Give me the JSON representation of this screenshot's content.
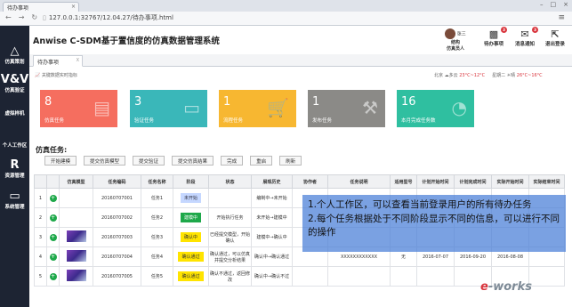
{
  "browser": {
    "tab_title": "待办事项",
    "url_host": "127.0.0.1",
    "url_path": ":32767/12.04.27/待办事项.html"
  },
  "sidebar": {
    "items": [
      {
        "label": "仿真策划",
        "icon": "triangle-icon"
      },
      {
        "label": "仿真验证",
        "icon": "vv-icon"
      },
      {
        "label": "虚拟样机",
        "icon": "prototype-icon"
      },
      {
        "label": "个人工作区",
        "icon": "workspace-icon"
      },
      {
        "label": "资源管理",
        "icon": "resource-icon"
      },
      {
        "label": "系统管理",
        "icon": "system-icon"
      }
    ]
  },
  "header": {
    "title": "Anwise C-SDM基于置信度的仿真数据管理系统",
    "user_name": "张三",
    "user_role_1": "结构",
    "user_role_2": "仿真员人",
    "todo_label": "待办事项",
    "todo_badge": "3",
    "notice_label": "消息通知",
    "notice_badge": "3",
    "logout_label": "退出登录"
  },
  "tabs": [
    {
      "label": "待办事项",
      "close": "X"
    }
  ],
  "kpi": {
    "title": "关键数据实时指标",
    "city1": "北京",
    "weather1": "多云",
    "temp1": "23°C~12°C",
    "day": "星期二",
    "weather2": "晴",
    "temp2": "26°C~16°C"
  },
  "cards": [
    {
      "value": "8",
      "label": "仿真任务",
      "color": "#f56e5f"
    },
    {
      "value": "3",
      "label": "验证任务",
      "color": "#3ab7b9"
    },
    {
      "value": "1",
      "label": "流程任务",
      "color": "#f7b731"
    },
    {
      "value": "1",
      "label": "发布任务",
      "color": "#8b8a87"
    },
    {
      "value": "16",
      "label": "本月完成任务数",
      "color": "#2fbfa0"
    }
  ],
  "section_title": "仿真任务:",
  "toolbar": [
    "开始建模",
    "提交仿真模型",
    "提交验证",
    "提交仿真结果",
    "完成",
    "重启",
    "刷新"
  ],
  "table": {
    "headers": [
      "",
      "",
      "仿真模型",
      "任务编码",
      "任务名称",
      "阶段",
      "状态",
      "展现历史",
      "协作者",
      "任务说明",
      "适用型号",
      "计划开始时间",
      "计划完成时间",
      "实际开始时间",
      "实际结束时间"
    ],
    "rows": [
      {
        "n": "1",
        "code": "20160707001",
        "name": "任务1",
        "stage": "未开始",
        "stage_cls": "s-ns",
        "status": "",
        "history": "编制中→未开始",
        "collab": "",
        "desc": "",
        "model": "",
        "ps": "",
        "pe": "",
        "as": "",
        "ae": ""
      },
      {
        "n": "2",
        "code": "20160707002",
        "name": "任务2",
        "stage": "建模中",
        "stage_cls": "s-ok",
        "status": "开始执行任务",
        "history": "未开始→建模中",
        "collab": "",
        "desc": "",
        "model": "",
        "ps": "",
        "pe": "",
        "as": "",
        "ae": ""
      },
      {
        "n": "3",
        "code": "20160707003",
        "name": "任务3",
        "stage": "确认中",
        "stage_cls": "s-cf",
        "status": "已经提交模型，开始确认",
        "history": "建模中→确认中",
        "collab": "",
        "desc": "",
        "model": "",
        "ps": "",
        "pe": "",
        "as": "",
        "ae": ""
      },
      {
        "n": "4",
        "code": "20160707004",
        "name": "任务4",
        "stage": "确认通过",
        "stage_cls": "s-cp",
        "status": "确认通过，可以仿真并提交分析结果",
        "history": "确认中→确认通过",
        "collab": "",
        "desc": "XXXXXXXXXXXX",
        "model": "无",
        "ps": "2016-07-07",
        "pe": "2016-09-20",
        "as": "2016-08-08",
        "ae": ""
      },
      {
        "n": "5",
        "code": "20160707005",
        "name": "任务5",
        "stage": "确认通过",
        "stage_cls": "s-cp",
        "status": "确认不通过，返回修改",
        "history": "确认中→确认不过",
        "collab": "",
        "desc": "",
        "model": "",
        "ps": "",
        "pe": "",
        "as": "",
        "ae": ""
      }
    ]
  },
  "overlay": {
    "line1": "1.个人工作区，可以查看当前登录用户的所有待办任务",
    "line2": "2.每个任务根据处于不同阶段显示不同的信息，可以进行不同的操作"
  },
  "watermark": {
    "e": "e",
    "rest": "-works"
  }
}
